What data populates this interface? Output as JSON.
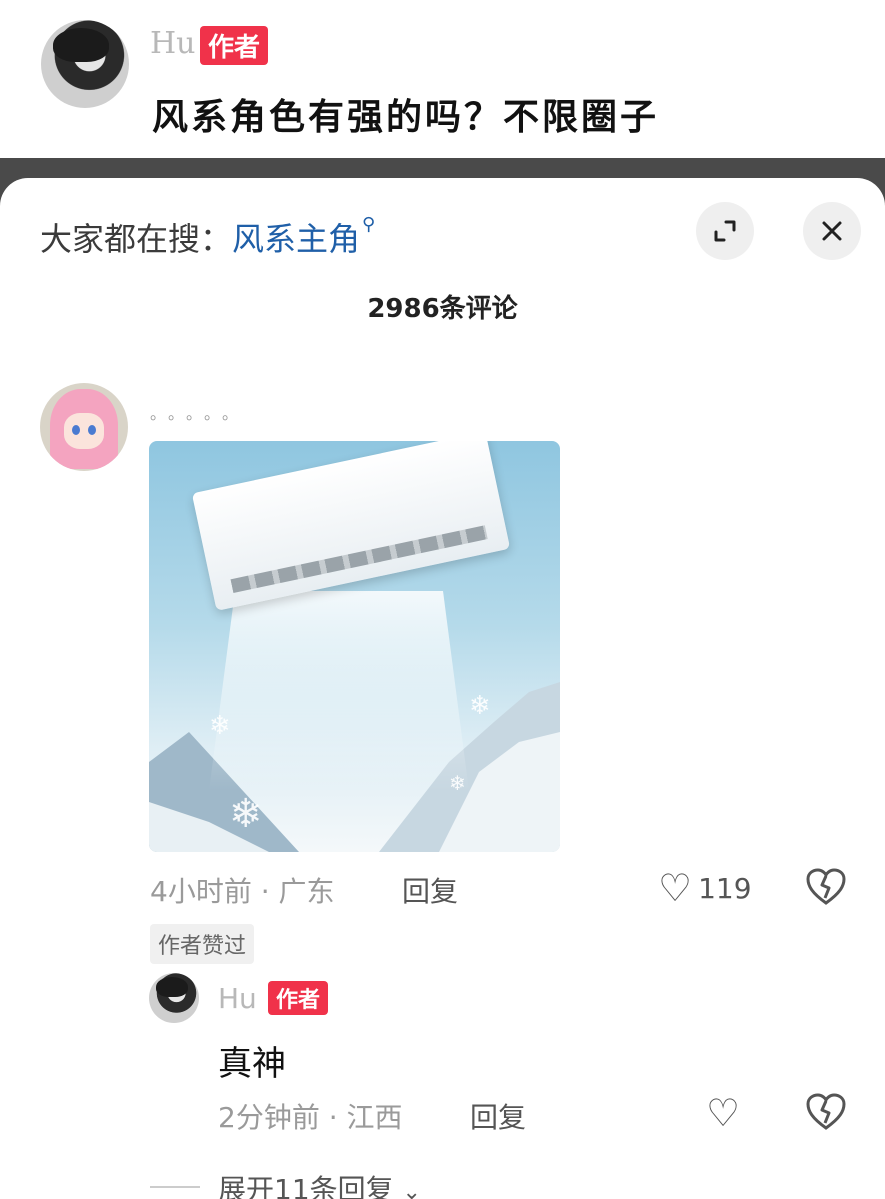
{
  "post": {
    "author": "Hu",
    "author_tag": "作者",
    "title": "风系角色有强的吗？不限圈子"
  },
  "sheet": {
    "search_prefix": "大家都在搜：",
    "search_term": "风系主角",
    "comment_count": "2986条评论"
  },
  "comment": {
    "username": "。。。。。",
    "time": "4小时前",
    "location": "广东",
    "reply_label": "回复",
    "likes": "119",
    "liked_badge": "作者赞过"
  },
  "reply": {
    "author": "Hu",
    "author_tag": "作者",
    "text": "真神",
    "time": "2分钟前",
    "location": "江西",
    "reply_label": "回复"
  },
  "expand_replies": "展开11条回复",
  "colors": {
    "author_tag_bg": "#f0324a",
    "search_term": "#1f5fa8"
  }
}
